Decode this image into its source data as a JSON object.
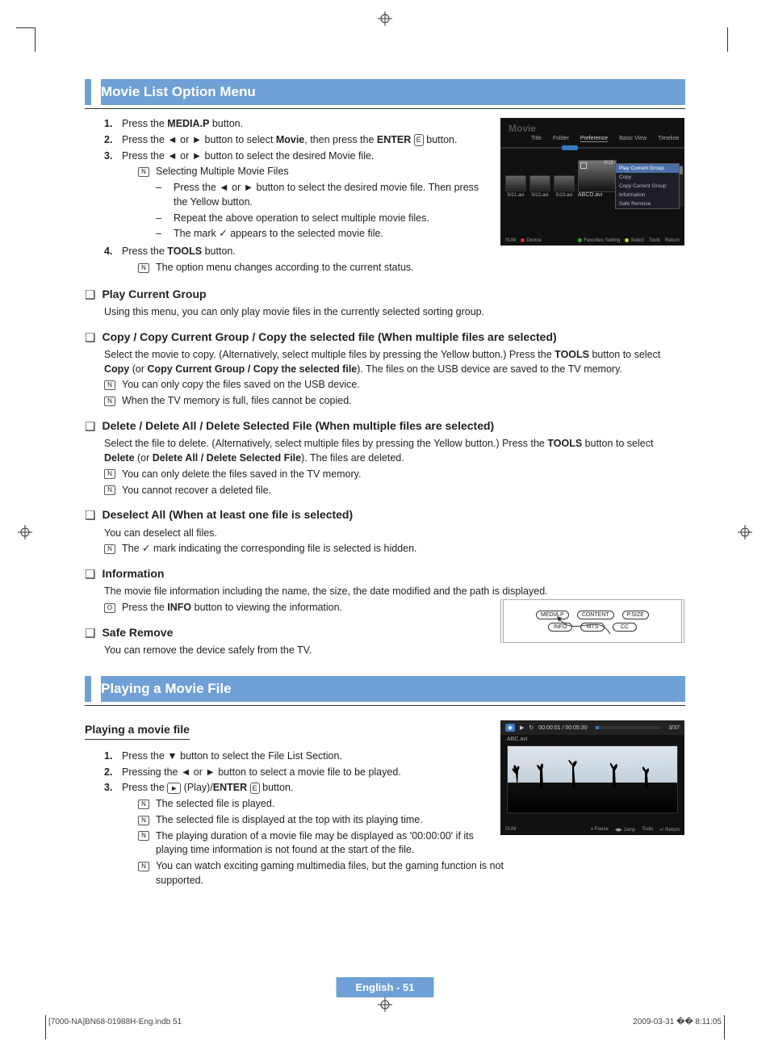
{
  "section1_title": "Movie List Option Menu",
  "steps1": [
    {
      "num": "1.",
      "pre": "Press the ",
      "b": "MEDIA.P",
      "post": " button."
    },
    {
      "num": "2.",
      "pre": "Press the ◄ or ► button to select ",
      "b": "Movie",
      "post": ", then press the ",
      "b2": "ENTER",
      "icon": "E",
      "post2": " button."
    },
    {
      "num": "3.",
      "pre": "Press the ◄ or ► button to select the desired Movie file.",
      "b": "",
      "post": ""
    }
  ],
  "step3_note_title": "Selecting Multiple Movie Files",
  "step3_dashes": [
    "Press the ◄ or ► button to select the desired movie file. Then press the Yellow button.",
    "Repeat the above operation to select multiple movie files.",
    "The mark ✓ appears to the selected movie file."
  ],
  "steps1_4": {
    "num": "4.",
    "pre": "Press the ",
    "b": "TOOLS",
    "post": " button."
  },
  "step4_note": "The option menu changes according to the current status.",
  "q_play": {
    "title": "Play Current Group",
    "body": "Using this menu, you can only play movie files in the currently selected sorting group."
  },
  "q_copy": {
    "title": "Copy / Copy Current Group / Copy the selected file (When multiple files are selected)",
    "body_pre": "Select the movie to copy. (Alternatively, select multiple files by pressing the Yellow button.) Press the ",
    "b1": "TOOLS",
    "body_mid": " button to select ",
    "b2": "Copy",
    "body_mid2": " (or ",
    "b3": "Copy Current Group / Copy the selected file",
    "body_post": "). The files on the USB device are saved to the TV memory.",
    "n1": "You can only copy the files saved on the USB device.",
    "n2": "When the TV memory is full, files cannot be copied."
  },
  "q_del": {
    "title": "Delete / Delete All / Delete Selected File (When multiple files are selected)",
    "body_pre": "Select the file to delete. (Alternatively, select multiple files by pressing the Yellow button.) Press the ",
    "b1": "TOOLS",
    "body_mid": " button to select ",
    "b2": "Delete",
    "body_mid2": " (or ",
    "b3": "Delete All / Delete Selected File",
    "body_post": "). The files are deleted.",
    "n1": "You can only delete the files saved in the TV memory.",
    "n2": "You cannot recover a deleted file."
  },
  "q_desel": {
    "title": "Deselect All (When at least one file is selected)",
    "body": "You can deselect all files.",
    "n1": "The ✓ mark indicating the corresponding file is selected is hidden."
  },
  "q_info": {
    "title": "Information",
    "body": "The movie file information including the name, the size, the date modified and the path is displayed.",
    "n1_pre": "Press the ",
    "n1_b": "INFO",
    "n1_post": " button to viewing the information."
  },
  "q_safe": {
    "title": "Safe Remove",
    "body": "You can remove the device safely from the TV."
  },
  "section2_title": "Playing a Movie File",
  "play_head": "Playing a movie file",
  "steps2": [
    {
      "num": "1.",
      "txt": "Press the ▼ button to select the File List Section."
    },
    {
      "num": "2.",
      "txt": "Pressing the ◄ or ► button to select a movie file to be played."
    },
    {
      "num": "3.",
      "pre": "Press the ",
      "play": "►",
      "mid": " (Play)/",
      "b": "ENTER",
      "icon": "E",
      "post": " button."
    }
  ],
  "steps2_notes": [
    "The selected file is played.",
    "The selected file is displayed at the top with its playing time.",
    "The playing duration of a movie file may be displayed as '00:00:00' if its playing time information is not found at the start of the file.",
    "You can watch exciting gaming multimedia files, but the gaming function is not supported."
  ],
  "shot1": {
    "title": "Movie",
    "tabs": [
      "Title",
      "Folder",
      "Preference",
      "Basic View",
      "Timeline"
    ],
    "thumbs": [
      "5/21.avi",
      "5/22.avi",
      "5/23.avi"
    ],
    "big": {
      "label": "ABCD.avi",
      "count": "5/15"
    },
    "menu": [
      "Play Current Group",
      "Copy",
      "Copy Current Group",
      "Information",
      "Safe Remove"
    ],
    "bottom_l": [
      "SUM",
      "Device"
    ],
    "bottom_r": [
      "Favorites Setting",
      "Select",
      "Tools",
      "Return"
    ]
  },
  "shot2": {
    "row1": [
      "MEDIA.P",
      "CONTENT",
      "P.SIZE"
    ],
    "row2": [
      "INFO",
      "MTS",
      "CC"
    ]
  },
  "shot3": {
    "time": "00:00:01 / 00:05:30",
    "count": "3/37",
    "file": "ABC.avi",
    "bottom_l": "SUM",
    "bottom_r": [
      "Pause",
      "Jump",
      "Tools",
      "Return"
    ]
  },
  "footer_page": "English - 51",
  "footer_left": "[7000-NA]BN68-01988H-Eng.indb   51",
  "footer_right": "2009-03-31   �� 8:11:05"
}
